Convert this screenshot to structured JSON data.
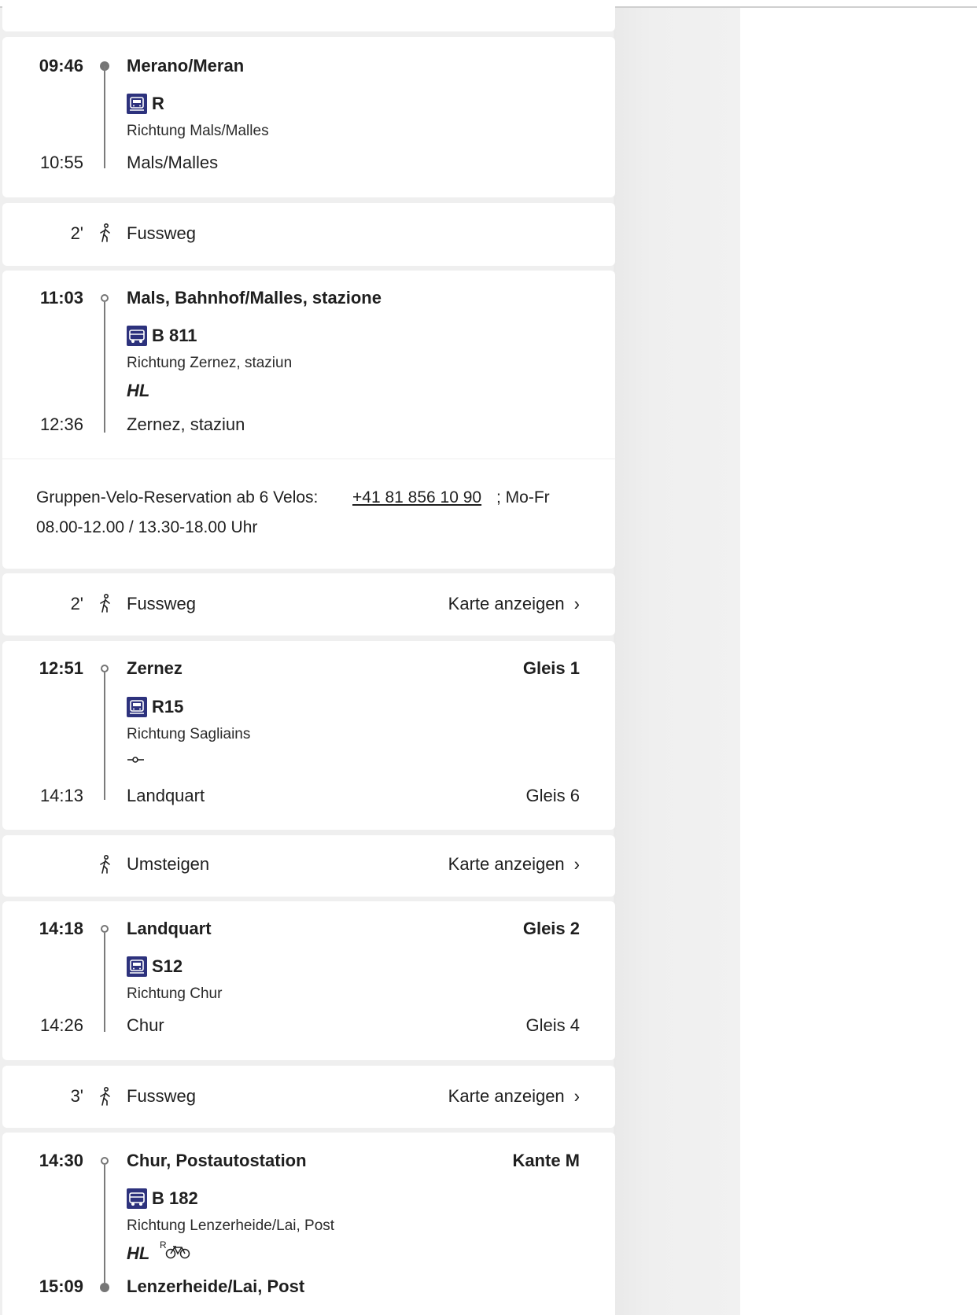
{
  "segments": {
    "s1": {
      "dep_time": "09:46",
      "dep_stop": "Merano/Meran",
      "product": "R",
      "direction": "Richtung Mals/Malles",
      "arr_time": "10:55",
      "arr_stop": "Mals/Malles"
    },
    "w1": {
      "duration": "2'",
      "label": "Fussweg"
    },
    "s2": {
      "dep_time": "11:03",
      "dep_stop": "Mals, Bahnhof/Malles, stazione",
      "product": "B 811",
      "direction": "Richtung Zernez, staziun",
      "attr": "HL",
      "arr_time": "12:36",
      "arr_stop": "Zernez, staziun",
      "info_prefix": "Gruppen-Velo-Reservation ab 6 Velos:",
      "info_phone": "+41 81 856 10 90",
      "info_suffix": "; Mo-Fr",
      "info_line2": "08.00-12.00 / 13.30-18.00 Uhr"
    },
    "w2": {
      "duration": "2'",
      "label": "Fussweg",
      "link": "Karte anzeigen"
    },
    "s3": {
      "dep_time": "12:51",
      "dep_stop": "Zernez",
      "dep_platform": "Gleis 1",
      "product": "R15",
      "direction": "Richtung Sagliains",
      "arr_time": "14:13",
      "arr_stop": "Landquart",
      "arr_platform": "Gleis 6"
    },
    "w3": {
      "label": "Umsteigen",
      "link": "Karte anzeigen"
    },
    "s4": {
      "dep_time": "14:18",
      "dep_stop": "Landquart",
      "dep_platform": "Gleis 2",
      "product": "S12",
      "direction": "Richtung Chur",
      "arr_time": "14:26",
      "arr_stop": "Chur",
      "arr_platform": "Gleis 4"
    },
    "w4": {
      "duration": "3'",
      "label": "Fussweg",
      "link": "Karte anzeigen"
    },
    "s5": {
      "dep_time": "14:30",
      "dep_stop": "Chur, Postautostation",
      "dep_platform": "Kante M",
      "product": "B 182",
      "direction": "Richtung Lenzerheide/Lai, Post",
      "attr": "HL",
      "bike_note": "R",
      "arr_time": "15:09",
      "arr_stop": "Lenzerheide/Lai, Post"
    }
  },
  "icons": {
    "train": "train-icon",
    "bus": "bus-icon",
    "walk": "walk-icon",
    "bike": "bike-icon",
    "chevron": "chevron-right-icon",
    "low_floor": "ramp-icon"
  },
  "colors": {
    "product_icon_bg": "#2d327d",
    "timeline": "#767676"
  }
}
